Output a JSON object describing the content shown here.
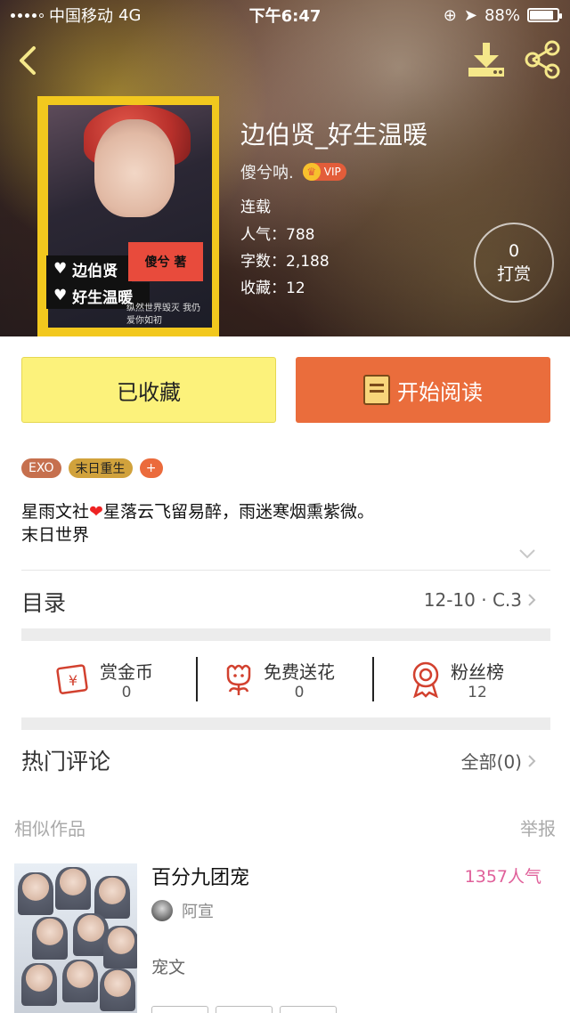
{
  "status_bar": {
    "carrier": "中国移动",
    "network": "4G",
    "time": "下午6:47",
    "battery_text": "88%",
    "battery_level": 0.88
  },
  "book": {
    "title": "边伯贤_好生温暖",
    "author": "傻兮呐.",
    "vip_label": "VIP",
    "status": "连载",
    "popularity_label": "人气：",
    "popularity": "788",
    "words_label": "字数：",
    "words": "2,188",
    "favorites_label": "收藏：",
    "favorites": "12",
    "reward_count": "0",
    "reward_label": "打赏",
    "cover": {
      "tag_line1": "边伯贤",
      "tag_line2": "好生温暖",
      "heart_text": "傻兮 著",
      "script_text": "纵然世界毁灭 我仍爱你如初"
    }
  },
  "actions": {
    "favorited_label": "已收藏",
    "read_label": "开始阅读"
  },
  "tags": [
    {
      "label": "EXO",
      "color": "#c6704e"
    },
    {
      "label": "末日重生",
      "color": "#d1a23c"
    },
    {
      "label": "+",
      "color": "#eb6b3c"
    }
  ],
  "description": {
    "line1_prefix": "星雨文社",
    "line1_suffix": "星落云飞留易醉，雨迷寒烟熏紫微。",
    "line2": "末日世界"
  },
  "toc": {
    "label": "目录",
    "latest": "12-10 · C.3"
  },
  "stats": [
    {
      "label": "赏金币",
      "value": "0",
      "icon": "red-envelope-icon"
    },
    {
      "label": "免费送花",
      "value": "0",
      "icon": "flower-icon"
    },
    {
      "label": "粉丝榜",
      "value": "12",
      "icon": "award-ribbon-icon"
    }
  ],
  "comments": {
    "label": "热门评论",
    "all_label": "全部(0)"
  },
  "similar": {
    "label": "相似作品",
    "report_label": "举报",
    "items": [
      {
        "title": "百分九团宠",
        "popularity": "1357人气",
        "author": "阿宣",
        "description": "宠文"
      }
    ]
  },
  "colors": {
    "accent_orange": "#ea6d3c",
    "favorite_yellow": "#fcf27b",
    "popularity_pink": "#e0609a",
    "icon_red": "#d2412f"
  }
}
